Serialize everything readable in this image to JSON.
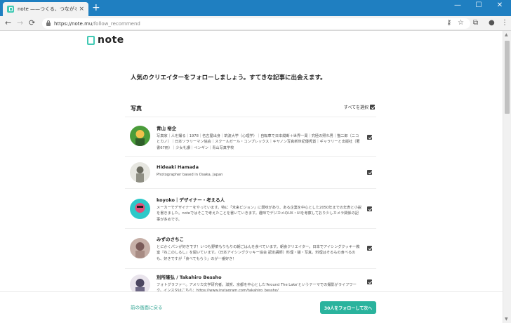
{
  "browser": {
    "tab_title": "note ——つくる、つながる、とどける。",
    "tab_close": "×",
    "new_tab": "+",
    "window_controls": {
      "minimize": "—",
      "maximize": "☐",
      "close": "✕"
    },
    "nav": {
      "back": "←",
      "forward": "→",
      "reload": "⟳"
    },
    "url_host": "https://note.mu",
    "url_path": "/follow_recommend",
    "toolbar_icons": {
      "key": "⚷",
      "star": "☆",
      "ext": "⧉",
      "account": "●",
      "menu": "⋮"
    }
  },
  "page": {
    "logo_text": "note",
    "headline": "人気のクリエイターをフォローしましょう。すてきな記事に出会えます。",
    "section_title": "写真",
    "select_all_label": "すべてを選択",
    "creators": [
      {
        "name": "青山 裕企",
        "bio": "写真家｜人を撮る｜1978｜名古屋出身｜筑波大学（心理学）｜自転車で日本縦断＋世界一周｜究極の照れ男｜猫二郎（ニコとカノ）｜日本ソラリーマン協会｜スクールガール・コンプレックス｜キヤノン写真新世紀優秀賞｜ギャラリーと出版社（著書67冊）｜少女礼讃｜ペンギン｜青山写真学校",
        "checked": true,
        "avatar_colors": [
          "#4a9c3a",
          "#f0c14b"
        ]
      },
      {
        "name": "Hideaki Hamada",
        "bio": "Photographer based in Osaka, Japan",
        "checked": true,
        "avatar_colors": [
          "#d8d8d0",
          "#6b6b60"
        ]
      },
      {
        "name": "koyoko｜デザイナー・考える人",
        "bio": "メーカーでデザイナーをやっています。特に「未来ビジョン」に興味があり、ある企業を中心とした2050年までの年表と小説を書きました。noteではそこで考えたことを書いていきます。趣味でデジカメのUX・UIを考察しており少しカメラ関係の記事が多めです。",
        "checked": true,
        "avatar_colors": [
          "#2ec9c9",
          "#e0507a"
        ]
      },
      {
        "name": "みずのさちこ",
        "bio": "とにかくパンが好きです！いつも野菜もりもりの朝ごはんを食べています。朝食クリエイター。日本でアイシングクッキー教室『ねこのしるし』を開いています。（日本アイシングクッキー協会 認定講師）料理・猫・写真。料理はそるもの食べるのも、好きですが「食べてもらう」のが一番好き！",
        "checked": true,
        "avatar_colors": [
          "#c7b0a8",
          "#7a5a58"
        ]
      },
      {
        "name": "別所隆弘 / Takahiro Bessho",
        "bio": "フォトグラファー。アメリカ文学研究者。滋賀、京都を中心とした'Around The Lake'というテーマでの撮影がライフワーク。インスタはこちら：https://www.instagram.com/takahiro_bessho/",
        "checked": true,
        "avatar_colors": [
          "#e9e4ec",
          "#4c4660"
        ]
      }
    ],
    "back_link": "前の画面に戻る",
    "next_button": "30人をフォローして次へ"
  }
}
